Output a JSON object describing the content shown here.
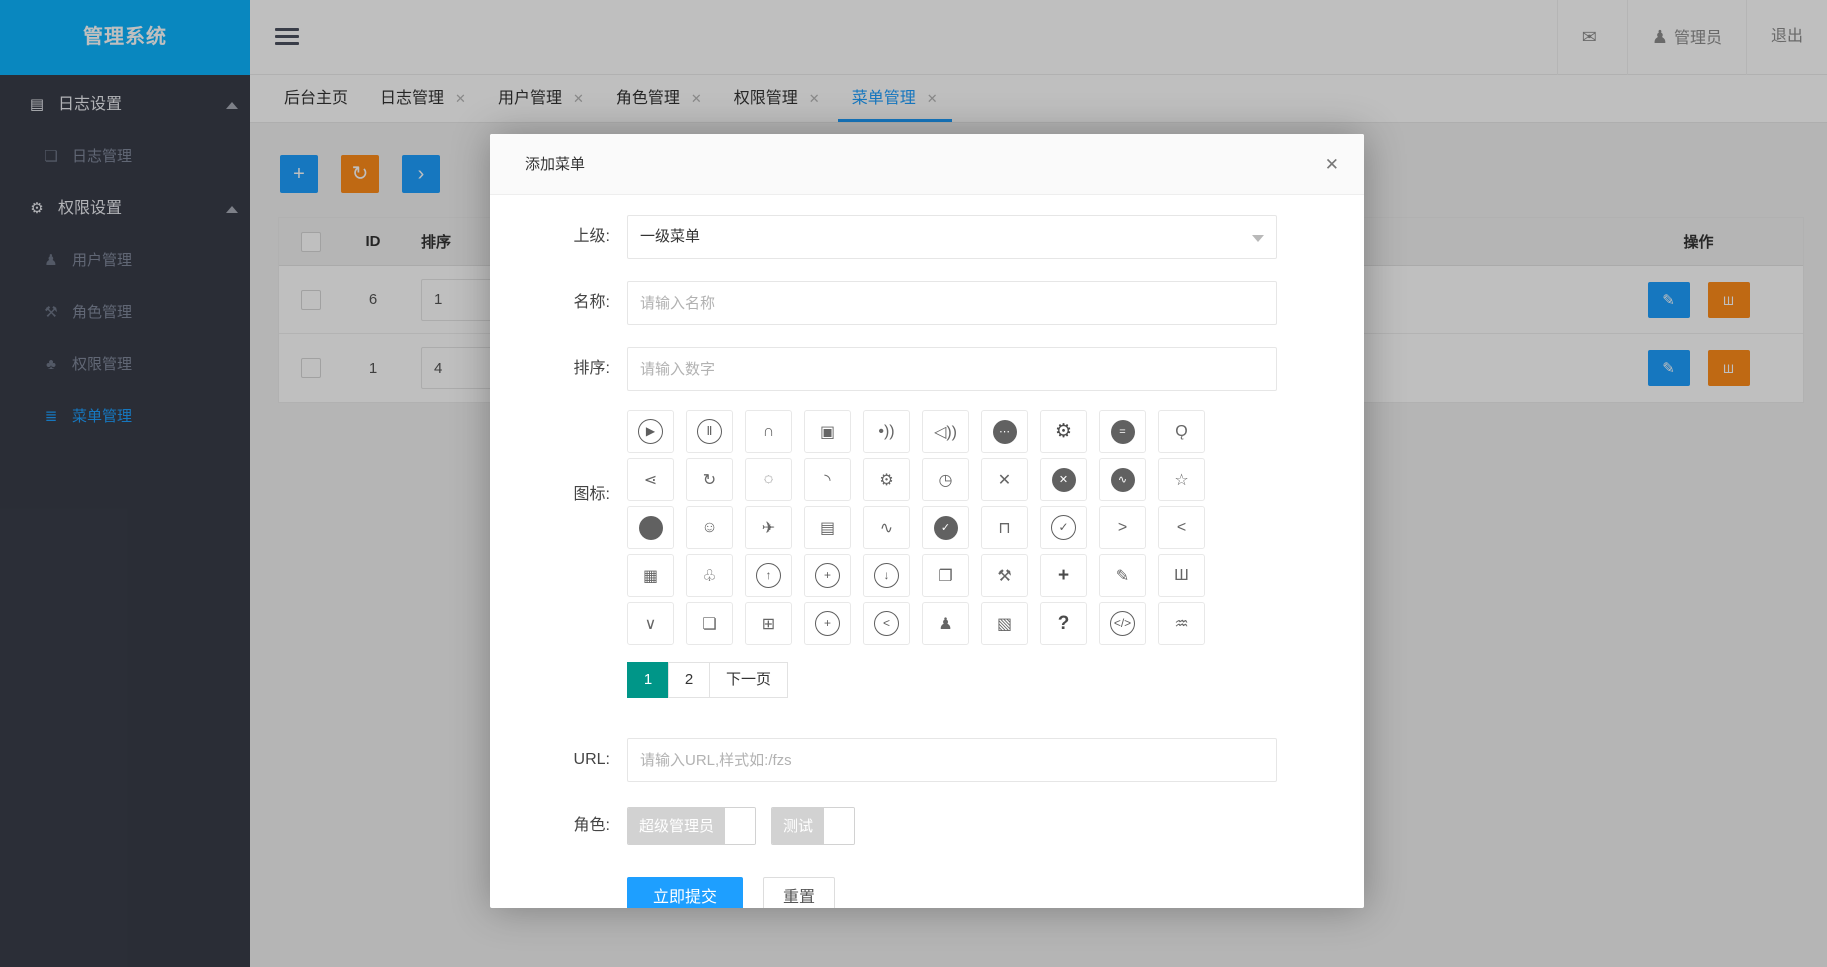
{
  "app": {
    "title": "管理系统"
  },
  "colors": {
    "primary": "#1E9FFF",
    "warn": "#FF8C1A",
    "pager_active": "#009688",
    "sidebar_bg": "#393D49",
    "logo_bg": "#0DB4FF"
  },
  "header": {
    "mail_glyph": "✉",
    "user_glyph": "♟",
    "user_label": "管理员",
    "logout_label": "退出"
  },
  "sidebar": {
    "items": [
      {
        "name": "log-settings",
        "label": "日志设置",
        "icon": "form-window-icon",
        "glyph": "▤",
        "type": "group"
      },
      {
        "name": "log-manage",
        "label": "日志管理",
        "icon": "file-icon",
        "glyph": "❏",
        "type": "sub"
      },
      {
        "name": "perm-settings",
        "label": "权限设置",
        "icon": "gear-icon",
        "glyph": "⚙",
        "type": "group"
      },
      {
        "name": "user-manage",
        "label": "用户管理",
        "icon": "user-icon",
        "glyph": "♟",
        "type": "sub"
      },
      {
        "name": "role-manage",
        "label": "角色管理",
        "icon": "tools-icon",
        "glyph": "⚒",
        "type": "sub"
      },
      {
        "name": "perm-manage",
        "label": "权限管理",
        "icon": "tree-icon",
        "glyph": "♣",
        "type": "sub"
      },
      {
        "name": "menu-manage",
        "label": "菜单管理",
        "icon": "menu-list-icon",
        "glyph": "≣",
        "type": "sub",
        "active": true
      }
    ]
  },
  "tabs": [
    {
      "name": "tab-home",
      "label": "后台主页",
      "closable": false
    },
    {
      "name": "tab-log-manage",
      "label": "日志管理",
      "closable": true
    },
    {
      "name": "tab-user-manage",
      "label": "用户管理",
      "closable": true
    },
    {
      "name": "tab-role-manage",
      "label": "角色管理",
      "closable": true
    },
    {
      "name": "tab-perm-manage",
      "label": "权限管理",
      "closable": true
    },
    {
      "name": "tab-menu-manage",
      "label": "菜单管理",
      "closable": true,
      "active": true
    }
  ],
  "tab_close_glyph": "✕",
  "toolbar": [
    {
      "name": "add-button",
      "icon": "plus-icon",
      "glyph": "+",
      "color": "#1E9FFF"
    },
    {
      "name": "refresh-button",
      "icon": "refresh-icon",
      "glyph": "↻",
      "color": "#FF8C1A"
    },
    {
      "name": "next-button",
      "icon": "arrow-right-icon",
      "glyph": "›",
      "color": "#1E9FFF"
    }
  ],
  "table": {
    "headers": {
      "id": "ID",
      "sort": "排序",
      "ops": "操作"
    },
    "rows": [
      {
        "id": "6",
        "sort": "1"
      },
      {
        "id": "1",
        "sort": "4"
      }
    ],
    "edit_glyph": "✎",
    "delete_glyph": "Ш"
  },
  "modal": {
    "title": "添加菜单",
    "close_glyph": "✕",
    "fields": {
      "parent": {
        "label": "上级:",
        "value": "一级菜单"
      },
      "name": {
        "label": "名称:",
        "placeholder": "请输入名称"
      },
      "sort": {
        "label": "排序:",
        "placeholder": "请输入数字"
      },
      "icon": {
        "label": "图标:"
      },
      "url": {
        "label": "URL:",
        "placeholder": "请输入URL,样式如:/fzs"
      },
      "roles": {
        "label": "角色:"
      }
    },
    "icons": [
      {
        "name": "play-icon",
        "glyph": "▶",
        "variant": "ring"
      },
      {
        "name": "pause-icon",
        "glyph": "Ⅱ",
        "variant": "ring"
      },
      {
        "name": "headset-icon",
        "glyph": "∩",
        "variant": "plain"
      },
      {
        "name": "video-icon",
        "glyph": "▣",
        "variant": "plain"
      },
      {
        "name": "signal-icon",
        "glyph": "•))",
        "variant": "plain"
      },
      {
        "name": "speaker-icon",
        "glyph": "◁))",
        "variant": "plain"
      },
      {
        "name": "chat-dots-icon",
        "glyph": "⋯",
        "variant": "fill"
      },
      {
        "name": "gear-solid-icon",
        "glyph": "⚙",
        "variant": "bold"
      },
      {
        "name": "list-circle-icon",
        "glyph": "=",
        "variant": "fill"
      },
      {
        "name": "search-icon",
        "glyph": "Ǫ",
        "variant": "plain"
      },
      {
        "name": "share-icon",
        "glyph": "⋖",
        "variant": "plain"
      },
      {
        "name": "refresh-icon",
        "glyph": "↻",
        "variant": "plain"
      },
      {
        "name": "loading-dots-icon",
        "glyph": "◌",
        "variant": "plain"
      },
      {
        "name": "loading-arc-icon",
        "glyph": "◝",
        "variant": "plain"
      },
      {
        "name": "gear-outline-icon",
        "glyph": "⚙",
        "variant": "plain"
      },
      {
        "name": "gauge-icon",
        "glyph": "◷",
        "variant": "plain"
      },
      {
        "name": "close-icon",
        "glyph": "✕",
        "variant": "plain"
      },
      {
        "name": "close-circle-icon",
        "glyph": "✕",
        "variant": "fill"
      },
      {
        "name": "chart-board-icon",
        "glyph": "∿",
        "variant": "fill"
      },
      {
        "name": "star-icon",
        "glyph": "☆",
        "variant": "plain"
      },
      {
        "name": "fingerprint-icon",
        "glyph": "",
        "variant": "fill"
      },
      {
        "name": "smile-icon",
        "glyph": "☺",
        "variant": "plain"
      },
      {
        "name": "send-icon",
        "glyph": "✈",
        "variant": "plain"
      },
      {
        "name": "file-text-icon",
        "glyph": "▤",
        "variant": "plain"
      },
      {
        "name": "pulse-icon",
        "glyph": "∿",
        "variant": "plain"
      },
      {
        "name": "check-circle-fill-icon",
        "glyph": "✓",
        "variant": "fill"
      },
      {
        "name": "tshirt-icon",
        "glyph": "⊓",
        "variant": "plain"
      },
      {
        "name": "check-circle-icon",
        "glyph": "✓",
        "variant": "ring"
      },
      {
        "name": "chevron-right-icon",
        "glyph": ">",
        "variant": "plain"
      },
      {
        "name": "chevron-left-icon",
        "glyph": "<",
        "variant": "plain"
      },
      {
        "name": "table-icon",
        "glyph": "▦",
        "variant": "plain"
      },
      {
        "name": "tree-icon",
        "glyph": "♧",
        "variant": "plain"
      },
      {
        "name": "arrow-up-circle-icon",
        "glyph": "↑",
        "variant": "ring"
      },
      {
        "name": "plus-circle-icon",
        "glyph": "+",
        "variant": "ring"
      },
      {
        "name": "arrow-down-circle-icon",
        "glyph": "↓",
        "variant": "ring"
      },
      {
        "name": "windows-icon",
        "glyph": "❐",
        "variant": "plain"
      },
      {
        "name": "tools-icon",
        "glyph": "⚒",
        "variant": "plain"
      },
      {
        "name": "plus-icon",
        "glyph": "+",
        "variant": "bold"
      },
      {
        "name": "pencil-icon",
        "glyph": "✎",
        "variant": "plain"
      },
      {
        "name": "trash-icon",
        "glyph": "Ш",
        "variant": "plain"
      },
      {
        "name": "chevron-down-icon",
        "glyph": "∨",
        "variant": "plain"
      },
      {
        "name": "file-icon",
        "glyph": "❏",
        "variant": "plain"
      },
      {
        "name": "window-icon",
        "glyph": "⊞",
        "variant": "plain"
      },
      {
        "name": "plus-circle-thin-icon",
        "glyph": "+",
        "variant": "ring"
      },
      {
        "name": "step-back-icon",
        "glyph": "<",
        "variant": "ring"
      },
      {
        "name": "group-icon",
        "glyph": "♟",
        "variant": "plain"
      },
      {
        "name": "image-icon",
        "glyph": "▧",
        "variant": "plain"
      },
      {
        "name": "question-icon",
        "glyph": "?",
        "variant": "bold"
      },
      {
        "name": "code-circle-icon",
        "glyph": "</>",
        "variant": "ring"
      },
      {
        "name": "water-drop-icon",
        "glyph": "♒",
        "variant": "plain"
      }
    ],
    "pagination": {
      "pages": [
        {
          "label": "1",
          "active": true
        },
        {
          "label": "2",
          "active": false
        }
      ],
      "next_label": "下一页"
    },
    "roles": [
      {
        "name": "super-admin",
        "label": "超级管理员",
        "checked": false
      },
      {
        "name": "test",
        "label": "测试",
        "checked": false
      }
    ],
    "submit_label": "立即提交",
    "reset_label": "重置"
  }
}
